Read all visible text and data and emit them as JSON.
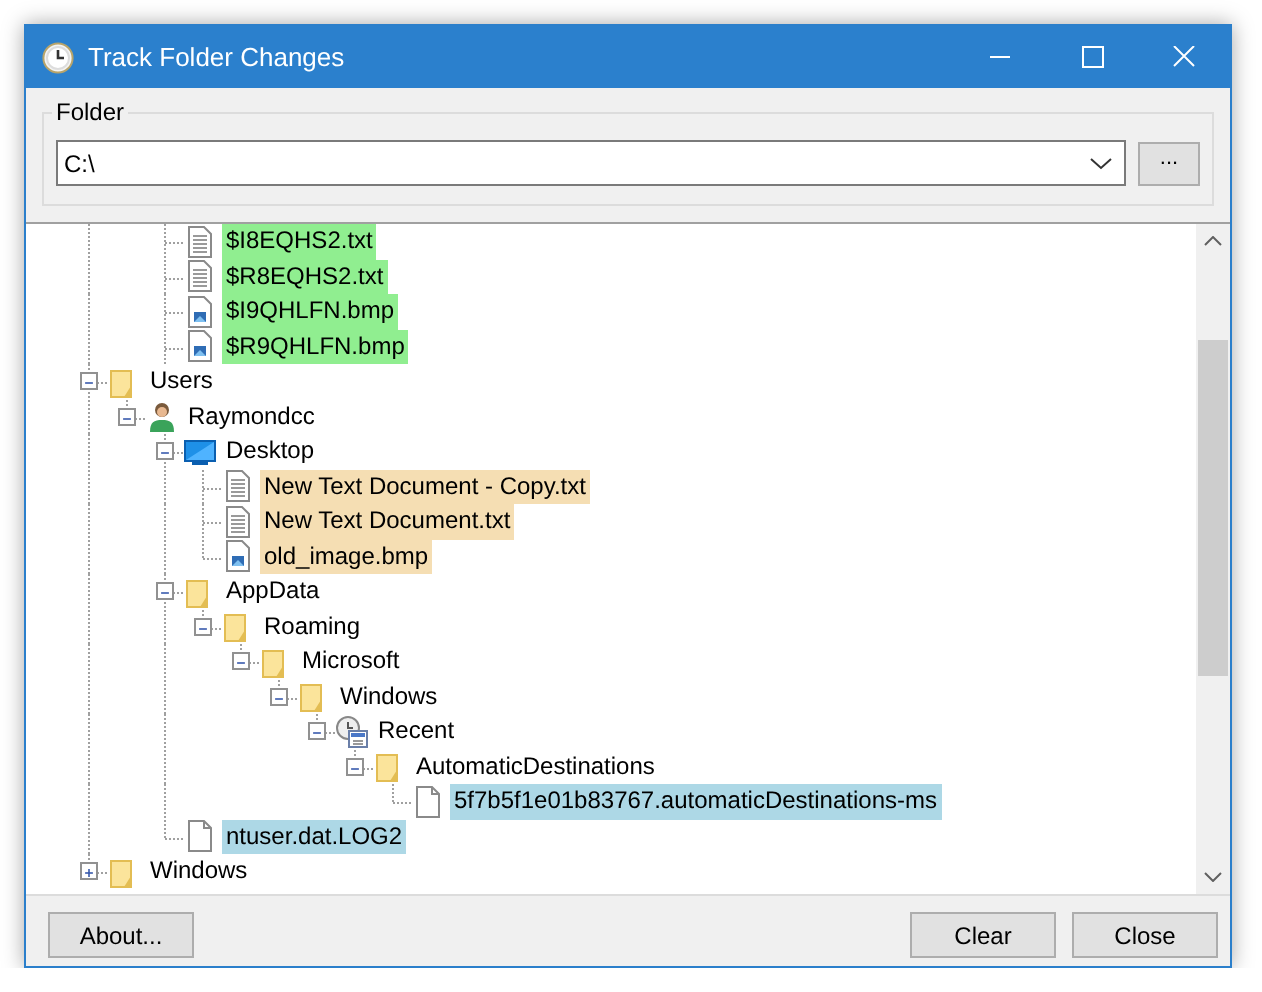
{
  "window": {
    "title": "Track Folder Changes"
  },
  "folder": {
    "label": "Folder",
    "value": "C:\\",
    "browse_button": "..."
  },
  "tree": {
    "scrolled_branch": [
      {
        "label": "$I8EQHS2.txt",
        "kind": "text-file",
        "color": "#90ee90"
      },
      {
        "label": "$R8EQHS2.txt",
        "kind": "text-file",
        "color": "#90ee90"
      },
      {
        "label": "$I9QHLFN.bmp",
        "kind": "image-file",
        "color": "#90ee90"
      },
      {
        "label": "$R9QHLFN.bmp",
        "kind": "image-file",
        "color": "#90ee90"
      }
    ],
    "items": [
      {
        "label": "Users",
        "kind": "folder",
        "expanded": true,
        "children": [
          {
            "label": "Raymondcc",
            "kind": "user",
            "expanded": true,
            "children": [
              {
                "label": "Desktop",
                "kind": "desktop",
                "expanded": true,
                "children": [
                  {
                    "label": "New Text Document - Copy.txt",
                    "kind": "text-file",
                    "color": "#f5deb3"
                  },
                  {
                    "label": "New Text Document.txt",
                    "kind": "text-file",
                    "color": "#f5deb3"
                  },
                  {
                    "label": "old_image.bmp",
                    "kind": "image-file",
                    "color": "#f5deb3"
                  }
                ]
              },
              {
                "label": "AppData",
                "kind": "folder",
                "expanded": true,
                "children": [
                  {
                    "label": "Roaming",
                    "kind": "folder",
                    "expanded": true,
                    "children": [
                      {
                        "label": "Microsoft",
                        "kind": "folder",
                        "expanded": true,
                        "children": [
                          {
                            "label": "Windows",
                            "kind": "folder",
                            "expanded": true,
                            "children": [
                              {
                                "label": "Recent",
                                "kind": "recent",
                                "expanded": true,
                                "children": [
                                  {
                                    "label": "AutomaticDestinations",
                                    "kind": "folder",
                                    "expanded": true,
                                    "children": [
                                      {
                                        "label": "5f7b5f1e01b83767.automaticDestinations-ms",
                                        "kind": "blank-file",
                                        "color": "#add8e6"
                                      }
                                    ]
                                  }
                                ]
                              }
                            ]
                          }
                        ]
                      }
                    ]
                  }
                ]
              },
              {
                "label": "ntuser.dat.LOG2",
                "kind": "blank-file",
                "color": "#add8e6"
              }
            ]
          }
        ]
      },
      {
        "label": "Windows",
        "kind": "folder",
        "expanded": false
      }
    ]
  },
  "buttons": {
    "about": "About...",
    "clear": "Clear",
    "close": "Close"
  }
}
